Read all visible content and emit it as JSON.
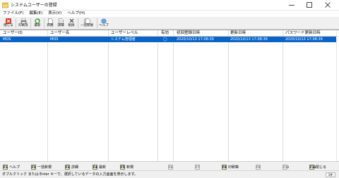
{
  "window": {
    "title": "システムユーザーの登録"
  },
  "menu": [
    "ファイル(F)",
    "編集(E)",
    "表示(V)",
    "ヘルプ(H)"
  ],
  "toolbar": {
    "close": "閉じる",
    "print": "印刷等",
    "refresh": "最新",
    "new": "新規",
    "detail": "詳細",
    "delete": "削除",
    "bulk_new": "一括新規",
    "help": "ヘルプ"
  },
  "grid": {
    "columns": [
      "ユーザーID",
      "ユーザー名",
      "ユーザーレベル",
      "有効",
      "初回登録日時",
      "更新日時",
      "パスワード更新日時"
    ],
    "rows": [
      {
        "user_id": "MOS",
        "user_name": "MOS",
        "level": "システム管理者",
        "active": "◯",
        "created": "2020/10/13 17:08:39",
        "updated": "2020/10/13 17:08:39",
        "pw_updated": "2020/10/13 17:08:39"
      }
    ]
  },
  "fkeys": {
    "f1": {
      "key": "F1",
      "label": "ヘルプ"
    },
    "f2": {
      "key": "F2",
      "label": "一括新規"
    },
    "f3": {
      "key": "F3",
      "label": "詳細"
    },
    "f4": {
      "key": "F4",
      "label": "最新"
    },
    "f5": {
      "key": "F5",
      "label": "新規"
    },
    "f6": {
      "key": "F6",
      "label": ""
    },
    "f7": {
      "key": "F7",
      "label": ""
    },
    "f8": {
      "key": "F8",
      "label": "印刷等"
    },
    "f9": {
      "key": "F9",
      "label": ""
    },
    "f10": {
      "key": "F10",
      "label": ""
    },
    "f11": {
      "key": "F11",
      "label": "閉じる"
    }
  },
  "status": {
    "text": "ダブルクリック または Enter キーで、選択しているデータの入力画面を表示します。",
    "indicator": "1件"
  },
  "colors": {
    "selection": "#0a64c8"
  }
}
